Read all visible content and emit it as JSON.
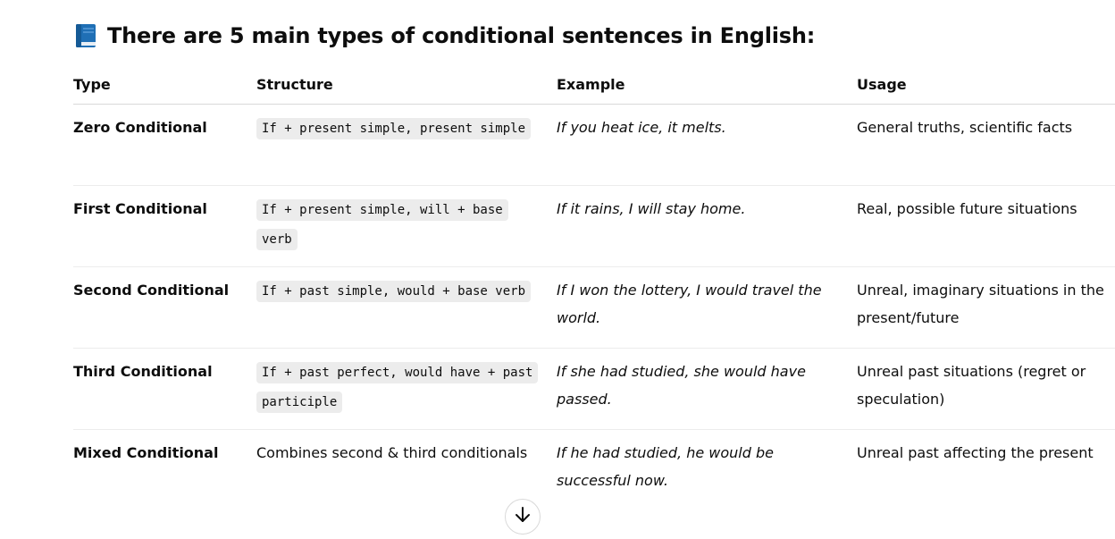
{
  "heading": {
    "icon": "blue-book-icon",
    "text": "There are 5 main types of conditional sentences in English:"
  },
  "table": {
    "headers": [
      "Type",
      "Structure",
      "Example",
      "Usage"
    ],
    "rows": [
      {
        "type": "Zero Conditional",
        "structure": "If + present simple, present simple",
        "structure_is_code": true,
        "example": "If you heat ice, it melts.",
        "usage": "General truths, scientific facts"
      },
      {
        "type": "First Conditional",
        "structure": "If + present simple, will + base verb",
        "structure_is_code": true,
        "example": "If it rains, I will stay home.",
        "usage": "Real, possible future situations"
      },
      {
        "type": "Second Conditional",
        "structure": "If + past simple, would + base verb",
        "structure_is_code": true,
        "example": "If I won the lottery, I would travel the world.",
        "usage": "Unreal, imaginary situations in the present/future"
      },
      {
        "type": "Third Conditional",
        "structure": "If + past perfect, would have + past participle",
        "structure_is_code": true,
        "example": "If she had studied, she would have passed.",
        "usage": "Unreal past situations (regret or speculation)"
      },
      {
        "type": "Mixed Conditional",
        "structure": "Combines second & third conditionals",
        "structure_is_code": false,
        "example": "If he had studied, he would be successful now.",
        "usage": "Unreal past affecting the present"
      }
    ]
  },
  "scroll_button": {
    "icon": "arrow-down-icon"
  },
  "colors": {
    "text": "#0d0d0d",
    "code_bg": "#ececec",
    "border": "#d9d9d9",
    "book_blue": "#1f6fb5"
  }
}
